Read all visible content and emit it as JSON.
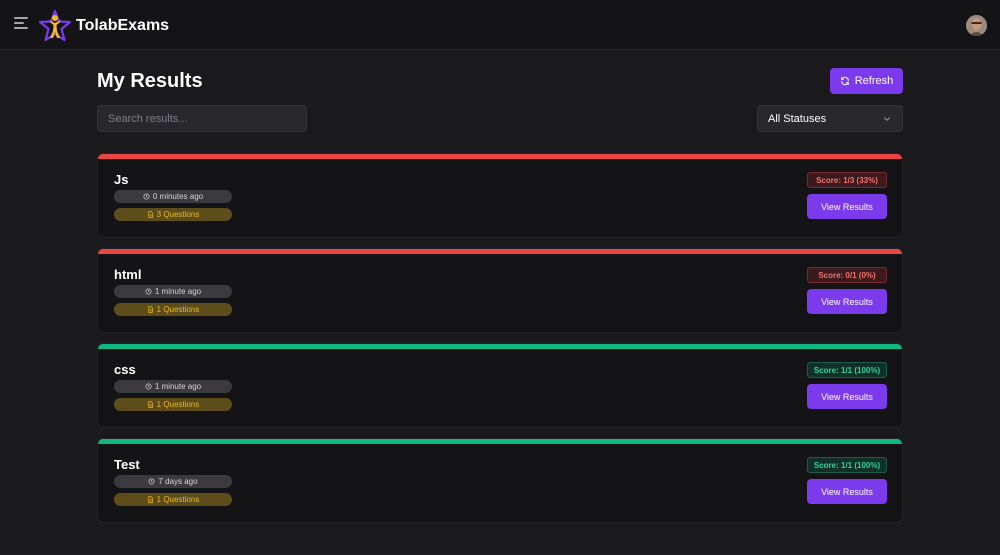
{
  "header": {
    "app_name": "TolabExams"
  },
  "page": {
    "title": "My Results",
    "refresh_label": "Refresh"
  },
  "filters": {
    "search_placeholder": "Search results...",
    "status_selected": "All Statuses"
  },
  "colors": {
    "accent": "#7c3aed",
    "fail": "#ef4444",
    "pass": "#10b981"
  },
  "results": [
    {
      "title": "Js",
      "time": "0 minutes ago",
      "questions": "3 Questions",
      "score": "Score: 1/3 (33%)",
      "status": "fail",
      "button": "View Results"
    },
    {
      "title": "html",
      "time": "1 minute ago",
      "questions": "1 Questions",
      "score": "Score: 0/1 (0%)",
      "status": "fail",
      "button": "View Results"
    },
    {
      "title": "css",
      "time": "1 minute ago",
      "questions": "1 Questions",
      "score": "Score: 1/1 (100%)",
      "status": "pass",
      "button": "View Results"
    },
    {
      "title": "Test",
      "time": "7 days ago",
      "questions": "1 Questions",
      "score": "Score: 1/1 (100%)",
      "status": "pass",
      "button": "View Results"
    }
  ]
}
